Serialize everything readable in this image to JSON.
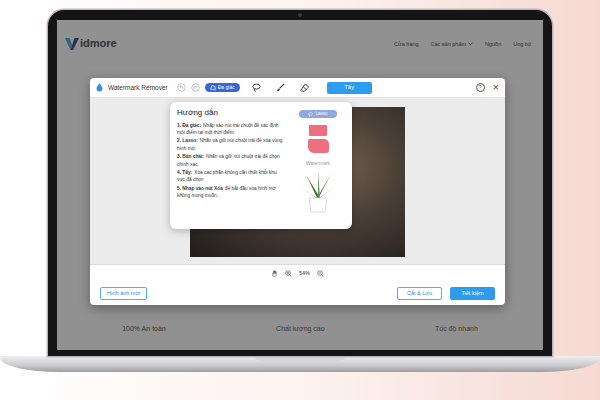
{
  "site": {
    "logo": "idmore",
    "nav": [
      {
        "label": "Cửa hàng",
        "kind": "link"
      },
      {
        "label": "Các sản phẩm",
        "kind": "menu"
      },
      {
        "label": "Nguồn",
        "kind": "link"
      },
      {
        "label": "Ủng hộ",
        "kind": "link"
      }
    ],
    "features": [
      "100% An toàn",
      "Chất lượng cao",
      "Tốc độ nhanh"
    ]
  },
  "modal": {
    "title": "Watermark Remover",
    "history": [
      {
        "kind": "undo",
        "disabled": true
      },
      {
        "kind": "redo",
        "disabled": true
      }
    ],
    "tools": [
      {
        "kind": "polygon",
        "label": "Đa giác",
        "selected": true
      },
      {
        "kind": "lasso",
        "selected": false
      },
      {
        "kind": "brush",
        "selected": false
      },
      {
        "kind": "eraser",
        "selected": false
      }
    ],
    "erase_button": "Tẩy",
    "help": "?",
    "close": "×",
    "zoom": "54%",
    "buttons": {
      "new_image": "Hình ảnh mới",
      "crop_save": "Cắt & Lưu",
      "save": "Tiết kiệm"
    }
  },
  "guide": {
    "title": "Hướng dẫn",
    "steps": [
      {
        "term": "1. Đa giác:",
        "text": "Nhấp vào nút trái chuột để xác định một điểm tại một thời điểm."
      },
      {
        "term": "2. Lasso:",
        "text": "Nhấn và giữ nút chuột trái để xóa vùng hình mờ."
      },
      {
        "term": "3. Bàn chải:",
        "text": "Nhấn và giữ nút chuột trái để chọn chính xác."
      },
      {
        "term": "4. Tẩy:",
        "text": "Xóa các phần không cần thiết khỏi khu vực đã chọn"
      },
      {
        "term": "5. Nhấp vào nút Xóa",
        "text": "để bắt đầu xóa hình mờ không mong muốn."
      }
    ],
    "sample_tool": "Lasso",
    "sample_watermark": "Watermark"
  }
}
